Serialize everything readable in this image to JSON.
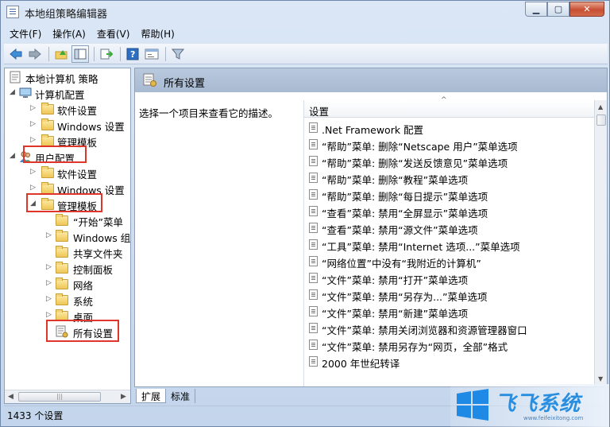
{
  "window": {
    "title": "本地组策略编辑器",
    "controls": {
      "minimize": "▁",
      "maximize": "▢",
      "close": "✕"
    }
  },
  "menu": [
    "文件(F)",
    "操作(A)",
    "查看(V)",
    "帮助(H)"
  ],
  "toolbar": [
    "back-icon",
    "forward-icon",
    "up-folder-icon",
    "show-hide-tree-icon",
    "export-list-icon",
    "help-icon",
    "properties-icon",
    "filter-icon"
  ],
  "tree": {
    "root": "本地计算机 策略",
    "computer_config": "计算机配置",
    "cc_software": "软件设置",
    "cc_windows": "Windows 设置",
    "cc_admin": "管理模板",
    "user_config": "用户配置",
    "uc_software": "软件设置",
    "uc_windows": "Windows 设置",
    "uc_admin": "管理模板",
    "at_start": "“开始”菜单",
    "at_windows": "Windows 组件",
    "at_shared": "共享文件夹",
    "at_control": "控制面板",
    "at_network": "网络",
    "at_system": "系统",
    "at_desktop": "桌面",
    "at_all": "所有设置"
  },
  "right": {
    "header": "所有设置",
    "description": "选择一个项目来查看它的描述。",
    "column": "设置",
    "items": [
      ".Net Framework 配置",
      "“帮助”菜单: 删除“Netscape 用户”菜单选项",
      "“帮助”菜单: 删除“发送反馈意见”菜单选项",
      "“帮助”菜单: 删除“教程”菜单选项",
      "“帮助”菜单: 删除“每日提示”菜单选项",
      "“查看”菜单: 禁用“全屏显示”菜单选项",
      "“查看”菜单: 禁用“源文件”菜单选项",
      "“工具”菜单: 禁用“Internet 选项...”菜单选项",
      "“网络位置”中没有“我附近的计算机”",
      "“文件”菜单: 禁用“打开”菜单选项",
      "“文件”菜单: 禁用“另存为...”菜单选项",
      "“文件”菜单: 禁用“新建”菜单选项",
      "“文件”菜单: 禁用关闭浏览器和资源管理器窗口",
      "“文件”菜单: 禁用另存为“网页，全部”格式",
      "2000 年世纪转译"
    ]
  },
  "tabs": [
    "扩展",
    "标准"
  ],
  "status": "1433 个设置",
  "watermark": {
    "text": "飞飞系统",
    "url": "www.feifeixitong.com"
  }
}
